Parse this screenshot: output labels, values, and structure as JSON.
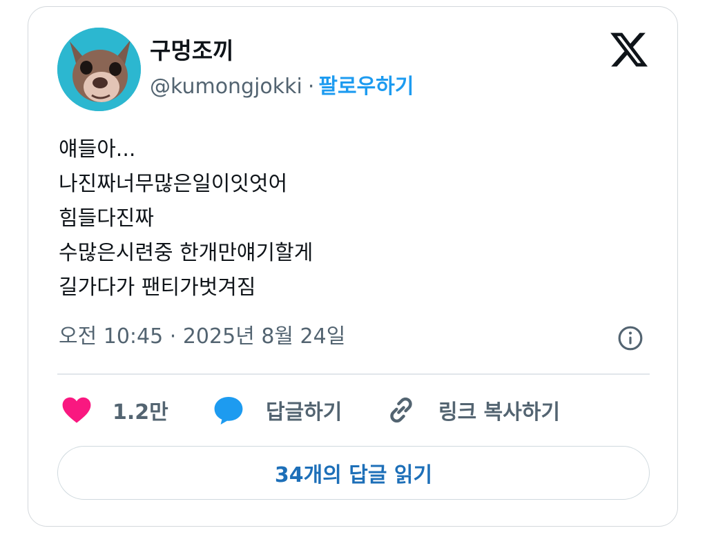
{
  "tweet": {
    "author": {
      "display_name": "구멍조끼",
      "handle": "@kumongjokki",
      "follow_label": "팔로우하기",
      "avatar": "chihuahua-avatar"
    },
    "platform_icon": "x-logo",
    "body_lines": [
      "얘들아...",
      "나진짜너무많은일이잇엇어",
      "힘들다진짜",
      "수많은시련중 한개만얘기할게",
      "길가다가 팬티가벗겨짐"
    ],
    "meta": {
      "time": "오전 10:45",
      "separator": "·",
      "date": "2025년 8월 24일"
    },
    "actions": {
      "likes_count": "1.2만",
      "reply_label": "답글하기",
      "copy_link_label": "링크 복사하기"
    },
    "read_replies_label": "34개의 답글 읽기",
    "colors": {
      "like": "#f91880",
      "reply": "#1d9bf0",
      "follow": "#1d9bf0",
      "secondary_text": "#536471"
    }
  }
}
